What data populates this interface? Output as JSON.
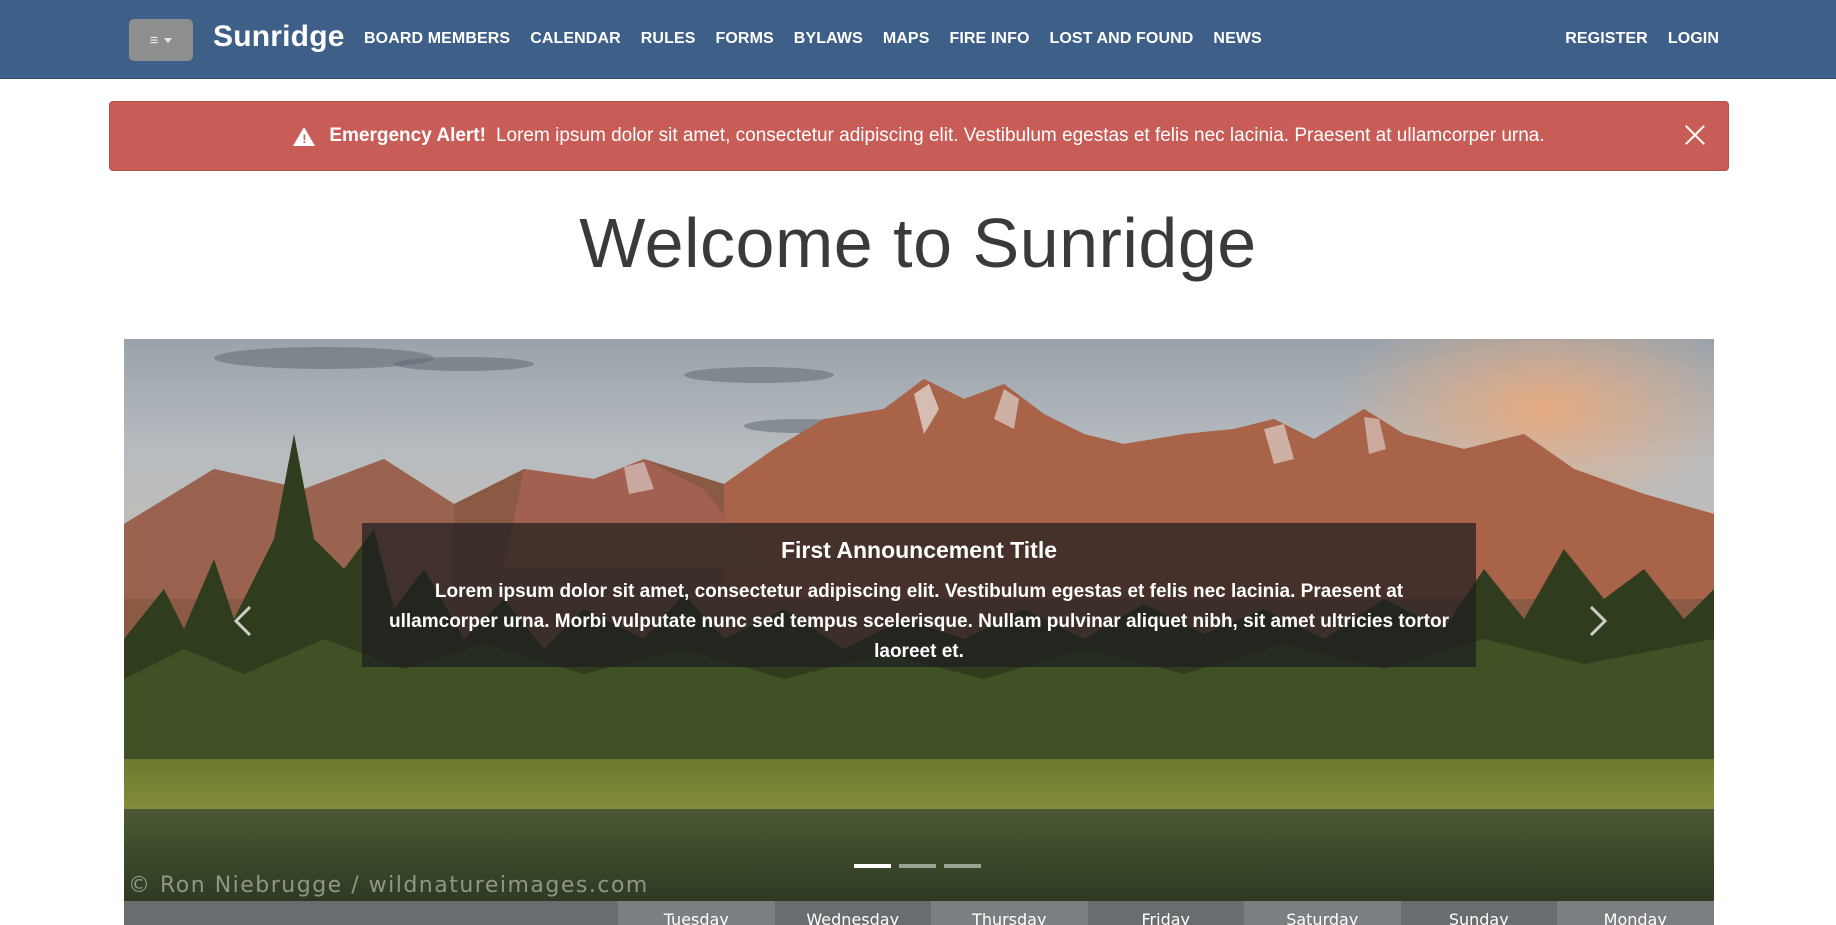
{
  "navbar": {
    "menu_icon": "hamburger-icon",
    "menu_glyph": "≡",
    "brand": "Sunridge",
    "links": [
      "BOARD MEMBERS",
      "CALENDAR",
      "RULES",
      "FORMS",
      "BYLAWS",
      "MAPS",
      "FIRE INFO",
      "LOST AND FOUND",
      "NEWS"
    ],
    "register": "REGISTER",
    "login": "LOGIN",
    "bg_color": "#3e5f88"
  },
  "alert": {
    "icon": "warning-icon",
    "title": "Emergency Alert!",
    "message": "Lorem ipsum dolor sit amet, consectetur adipiscing elit. Vestibulum egestas et felis nec lacinia. Praesent at ullamcorper urna.",
    "close_icon": "close-icon",
    "bg_color": "#c85d57"
  },
  "page": {
    "title": "Welcome to Sunridge"
  },
  "carousel": {
    "caption_title": "First Announcement Title",
    "caption_text": "Lorem ipsum dolor sit amet, consectetur adipiscing elit. Vestibulum egestas et felis nec lacinia. Praesent at ullamcorper urna. Morbi vulputate nunc sed tempus scelerisque. Nullam pulvinar aliquet nibh, sit amet ultricies tortor laoreet et.",
    "watermark": "© Ron Niebrugge / wildnatureimages.com",
    "slide_count": 3,
    "active_slide": 1,
    "prev_icon": "chevron-left-icon",
    "next_icon": "chevron-right-icon"
  },
  "weekdays": [
    "Tuesday",
    "Wednesday",
    "Thursday",
    "Friday",
    "Saturday",
    "Sunday",
    "Monday"
  ]
}
